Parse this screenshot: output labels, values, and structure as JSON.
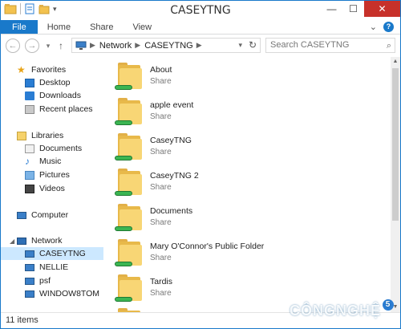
{
  "window": {
    "title": "CASEYTNG",
    "controls": {
      "minimize": "—",
      "maximize": "☐",
      "close": "✕"
    }
  },
  "ribbon": {
    "tabs": [
      "File",
      "Home",
      "Share",
      "View"
    ],
    "expand_icon": "⌄",
    "help": "?"
  },
  "address": {
    "back": "←",
    "forward": "→",
    "recent": "▾",
    "up": "↑",
    "crumbs": [
      "Network",
      "CASEYTNG"
    ],
    "search_placeholder": "Search CASEYTNG"
  },
  "nav": {
    "favorites": "Favorites",
    "desktop": "Desktop",
    "downloads": "Downloads",
    "recent_places": "Recent places",
    "libraries": "Libraries",
    "documents": "Documents",
    "music": "Music",
    "pictures": "Pictures",
    "videos": "Videos",
    "computer": "Computer",
    "network": "Network",
    "network_items": [
      "CASEYTNG",
      "NELLIE",
      "psf",
      "WINDOW8TOM"
    ]
  },
  "items": [
    {
      "name": "About",
      "type": "Share"
    },
    {
      "name": "apple event",
      "type": "Share"
    },
    {
      "name": "CaseyTNG",
      "type": "Share"
    },
    {
      "name": "CaseyTNG 2",
      "type": "Share"
    },
    {
      "name": "Documents",
      "type": "Share"
    },
    {
      "name": "Mary O'Connor's Public Folder",
      "type": "Share"
    },
    {
      "name": "Tardis",
      "type": "Share"
    }
  ],
  "status": {
    "count": "11 items"
  },
  "watermark": {
    "text": "CÔNGNGHỆ",
    "badge": "5"
  }
}
